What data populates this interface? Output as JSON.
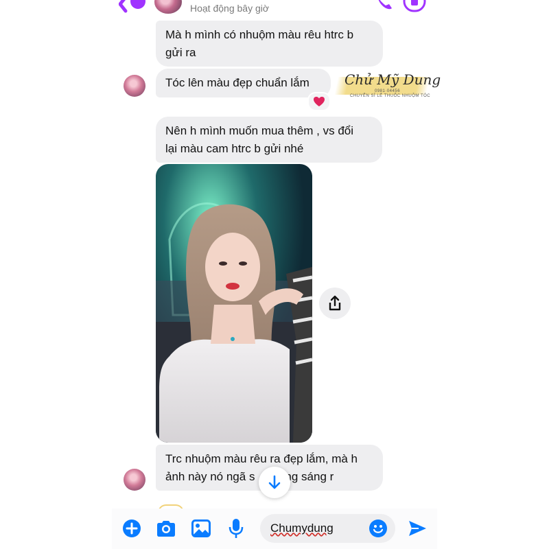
{
  "header": {
    "status": "Hoạt động bây giờ"
  },
  "messages": [
    {
      "text_line1": "Mà h mình có nhuộm màu rêu htrc b",
      "text_line2": "gửi ra"
    },
    {
      "text": "Tóc lên màu đẹp chuẩn lắm",
      "reaction": "heart"
    },
    {
      "text_line1": "Nên h mình muốn mua thêm , vs đổi",
      "text_line2": "lại màu cam htrc b gửi nhé"
    },
    {
      "type": "photo"
    },
    {
      "text_line1": "Trc nhuộm màu rêu ra đẹp lắm, mà h",
      "text_line2": "ảnh này nó ngã s",
      "text_line2_tail": "vàng sáng r"
    }
  ],
  "watermark": {
    "name": "Chử Mỹ Dung",
    "phone": "0981·04456",
    "tagline": "CHUYÊN SỈ LẺ THUỐC NHUỘM TÓC"
  },
  "composer": {
    "input_value": "Chumydung"
  },
  "colors": {
    "accent": "#0a7cff",
    "messenger_purple": "#a033ff",
    "bubble": "#eeeef0",
    "heart": "#e0245e"
  },
  "icons": [
    "back-icon",
    "call-icon",
    "video-icon",
    "heart-icon",
    "share-icon",
    "arrow-down-icon",
    "plus-icon",
    "camera-icon",
    "image-icon",
    "microphone-icon",
    "emoji-icon",
    "send-icon"
  ]
}
